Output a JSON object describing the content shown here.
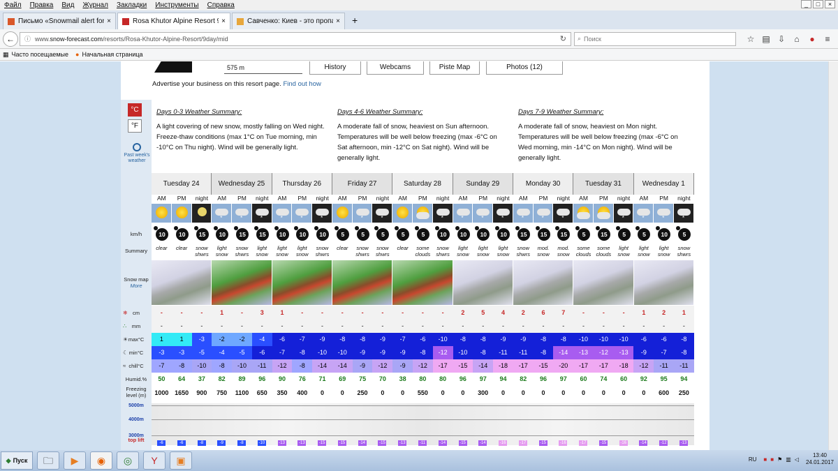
{
  "menu": [
    "Файл",
    "Правка",
    "Вид",
    "Журнал",
    "Закладки",
    "Инструменты",
    "Справка"
  ],
  "tabs": [
    {
      "label": "Письмо «Snowmail alert for 4...",
      "icon": "mail-icon",
      "color": "#d9582b"
    },
    {
      "label": "Rosa Khutor Alpine Resort 9 ...",
      "icon": "site-icon",
      "color": "#c62828"
    },
    {
      "label": "Савченко: Киев - это пропа...",
      "icon": "page-icon",
      "color": "#e7a73c"
    }
  ],
  "url": {
    "prefix": "www.",
    "host": "snow-forecast.com",
    "path": "/resorts/Rosa-Khutor-Alpine-Resort/9day/mid"
  },
  "search_placeholder": "Поиск",
  "bookmarks": [
    "Часто посещаемые",
    "Начальная страница"
  ],
  "header": {
    "elevation": "575 m",
    "buttons": [
      "History",
      "Webcams",
      "Piste Map",
      "Photos (12)"
    ],
    "advert": "Advertise your business on this resort page.",
    "advert_link": "Find out how"
  },
  "units": {
    "c": "°C",
    "f": "°F",
    "past": "Past week's weather"
  },
  "summaries": [
    {
      "title": "Days 0-3 Weather Summary:",
      "text": "A light covering of new snow, mostly falling on Wed night. Freeze-thaw conditions (max 1°C on Tue morning, min -10°C on Thu night). Wind will be generally light."
    },
    {
      "title": "Days 4-6 Weather Summary:",
      "text": "A moderate fall of snow, heaviest on Sun afternoon. Temperatures will be well below freezing (max -6°C on Sat afternoon, min -12°C on Sat night). Wind will be generally light."
    },
    {
      "title": "Days 7-9 Weather Summary:",
      "text": "A moderate fall of snow, heaviest on Mon night. Temperatures will be well below freezing (max -6°C on Wed morning, min -14°C on Mon night). Wind will be generally light."
    }
  ],
  "row_labels": {
    "wind": "km/h",
    "summary": "Summary",
    "map": "Snow map",
    "map_more": "More",
    "snow": "cm",
    "rain": "mm",
    "max": "max°C",
    "min": "min°C",
    "chill": "chill°C",
    "humid": "Humid.%",
    "freeze": "Freezing level (m)",
    "top": "top lift",
    "alt": [
      "5000m",
      "4000m",
      "3000m"
    ]
  },
  "periods": [
    "AM",
    "PM",
    "night"
  ],
  "days": [
    "Tuesday 24",
    "Wednesday 25",
    "Thursday 26",
    "Friday 27",
    "Saturday 28",
    "Sunday 29",
    "Monday 30",
    "Tuesday 31",
    "Wednesday 1"
  ],
  "forecast": {
    "icons": [
      "sun",
      "sun",
      "moon",
      "cloud-snow",
      "cloud-snow",
      "night-snow",
      "cloud-snow",
      "cloud-snow",
      "night-snow",
      "sun",
      "cloud-snow",
      "night-snow",
      "sun",
      "cloud-sun",
      "night-snow",
      "cloud-snow",
      "cloud-snow",
      "night-snow",
      "cloud-snow",
      "cloud-snow",
      "night-snow",
      "cloud-sun",
      "cloud-sun",
      "night-snow",
      "cloud-snow",
      "cloud-snow",
      "night-snow"
    ],
    "wind": [
      "10",
      "10",
      "15",
      "10",
      "15",
      "15",
      "10",
      "10",
      "10",
      "5",
      "5",
      "5",
      "5",
      "5",
      "10",
      "10",
      "10",
      "10",
      "15",
      "15",
      "15",
      "5",
      "15",
      "5",
      "5",
      "10",
      "5"
    ],
    "summary": [
      "clear",
      "clear",
      "snow shwrs",
      "light snow",
      "snow shwrs",
      "light snow",
      "light snow",
      "light snow",
      "snow shwrs",
      "clear",
      "snow shwrs",
      "snow shwrs",
      "clear",
      "some clouds",
      "snow shwrs",
      "light snow",
      "light snow",
      "light snow",
      "snow shwrs",
      "mod. snow",
      "mod. snow",
      "some clouds",
      "some clouds",
      "light snow",
      "light snow",
      "light snow",
      "snow shwrs"
    ],
    "maps": [
      "pale",
      "green",
      "green",
      "green",
      "green",
      "pale",
      "pale",
      "pale",
      "pale"
    ],
    "snow": [
      "-",
      "-",
      "-",
      "1",
      "-",
      "3",
      "1",
      "-",
      "-",
      "-",
      "-",
      "-",
      "-",
      "-",
      "-",
      "2",
      "5",
      "4",
      "2",
      "6",
      "7",
      "-",
      "-",
      "-",
      "1",
      "2",
      "1"
    ],
    "rain": [
      "-",
      "-",
      "-",
      "-",
      "-",
      "-",
      "-",
      "-",
      "-",
      "-",
      "-",
      "-",
      "-",
      "-",
      "-",
      "-",
      "-",
      "-",
      "-",
      "-",
      "-",
      "-",
      "-",
      "-",
      "-",
      "-",
      "-"
    ],
    "max": [
      "1",
      "1",
      "-3",
      "-2",
      "-2",
      "-4",
      "-6",
      "-7",
      "-9",
      "-8",
      "-8",
      "-9",
      "-7",
      "-6",
      "-10",
      "-8",
      "-8",
      "-9",
      "-9",
      "-8",
      "-8",
      "-10",
      "-10",
      "-10",
      "-6",
      "-6",
      "-8"
    ],
    "min": [
      "-3",
      "-3",
      "-5",
      "-4",
      "-5",
      "-6",
      "-7",
      "-8",
      "-10",
      "-10",
      "-9",
      "-9",
      "-9",
      "-8",
      "-12",
      "-10",
      "-8",
      "-11",
      "-11",
      "-8",
      "-14",
      "-13",
      "-12",
      "-13",
      "-9",
      "-7",
      "-8"
    ],
    "chill": [
      "-7",
      "-8",
      "-10",
      "-8",
      "-10",
      "-11",
      "-12",
      "-8",
      "-14",
      "-14",
      "-9",
      "-12",
      "-9",
      "-12",
      "-17",
      "-15",
      "-14",
      "-18",
      "-17",
      "-15",
      "-20",
      "-17",
      "-17",
      "-18",
      "-12",
      "-11",
      "-11"
    ],
    "humid": [
      "50",
      "64",
      "37",
      "82",
      "89",
      "96",
      "90",
      "76",
      "71",
      "69",
      "75",
      "70",
      "38",
      "80",
      "80",
      "96",
      "97",
      "94",
      "82",
      "96",
      "97",
      "60",
      "74",
      "60",
      "92",
      "95",
      "94"
    ],
    "freeze": [
      "1000",
      "1650",
      "900",
      "750",
      "1100",
      "650",
      "350",
      "400",
      "0",
      "0",
      "250",
      "0",
      "0",
      "550",
      "0",
      "0",
      "300",
      "0",
      "0",
      "0",
      "0",
      "0",
      "0",
      "0",
      "0",
      "600",
      "250"
    ],
    "top": [
      "-6",
      "-6",
      "-8",
      "-9",
      "-8",
      "-10",
      "-13",
      "-13",
      "-15",
      "-15",
      "-14",
      "-15",
      "-13",
      "-11",
      "-14",
      "-15",
      "-14",
      "-16",
      "-17",
      "-15",
      "-16",
      "-17",
      "-15",
      "-16",
      "-14",
      "-12",
      "-13"
    ]
  },
  "taskbar": {
    "start": "Пуск",
    "lang": "RU",
    "time": "13:40",
    "date": "24.01.2017"
  }
}
